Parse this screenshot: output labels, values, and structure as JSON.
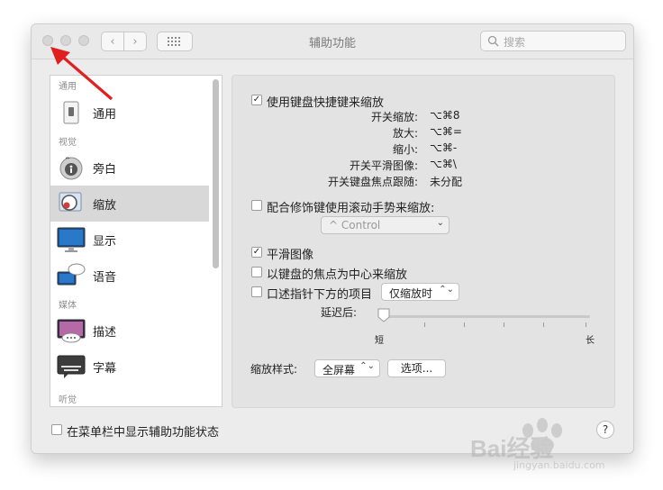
{
  "window": {
    "title": "辅助功能",
    "search_placeholder": "搜索",
    "nav_back": "‹",
    "nav_forward": "›",
    "grid_icon": "grid-icon"
  },
  "sidebar": {
    "headers": [
      "通用",
      "视觉",
      "媒体",
      "听觉"
    ],
    "items": [
      {
        "label": "通用",
        "icon": "general-icon"
      },
      {
        "label": "旁白",
        "icon": "voiceover-icon"
      },
      {
        "label": "缩放",
        "icon": "zoom-icon",
        "selected": true
      },
      {
        "label": "显示",
        "icon": "display-icon"
      },
      {
        "label": "语音",
        "icon": "speech-icon"
      },
      {
        "label": "描述",
        "icon": "descriptions-icon"
      },
      {
        "label": "字幕",
        "icon": "captions-icon"
      }
    ]
  },
  "zoom": {
    "keyboard_shortcuts": {
      "label": "使用键盘快捷键来缩放",
      "checked": true
    },
    "shortcuts": [
      {
        "label": "开关缩放:",
        "value": "⌥⌘8"
      },
      {
        "label": "放大:",
        "value": "⌥⌘="
      },
      {
        "label": "缩小:",
        "value": "⌥⌘-"
      },
      {
        "label": "开关平滑图像:",
        "value": "⌥⌘\\"
      },
      {
        "label": "开关键盘焦点跟随:",
        "value": "未分配"
      }
    ],
    "scroll_gesture": {
      "label": "配合修饰键使用滚动手势来缩放:",
      "checked": false
    },
    "modifier_popup": "^ Control",
    "smooth_images": {
      "label": "平滑图像",
      "checked": true
    },
    "follow_focus": {
      "label": "以键盘的焦点为中心来缩放",
      "checked": false
    },
    "speak_items": {
      "label": "口述指针下方的项目",
      "checked": false
    },
    "speak_popup": "仅缩放时",
    "delay_label": "延迟后:",
    "delay_short": "短",
    "delay_long": "长",
    "delay_level": 0,
    "style_label": "缩放样式:",
    "style_popup": "全屏幕",
    "options_button": "选项..."
  },
  "footer": {
    "show_status": {
      "label": "在菜单栏中显示辅助功能状态",
      "checked": false
    },
    "help": "?"
  },
  "watermark": {
    "text": "Bai经验",
    "subtext": "jingyan.baidu.com"
  },
  "colors": {
    "annotation_arrow": "#e02020",
    "selection": "#d8d8d8"
  }
}
